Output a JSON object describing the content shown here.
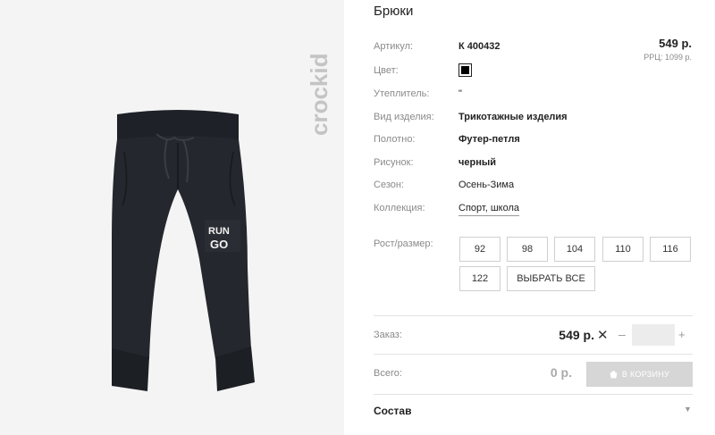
{
  "product": {
    "title": "Брюки",
    "brand": "crockid",
    "price": "549 р.",
    "rrp": "РРЦ: 1099 р.",
    "print_text": "RUN GO"
  },
  "attributes": [
    {
      "label": "Артикул:",
      "value": "К 400432"
    },
    {
      "label": "Цвет:",
      "value": ""
    },
    {
      "label": "Утеплитель:",
      "value": "\""
    },
    {
      "label": "Вид изделия:",
      "value": "Трикотажные изделия"
    },
    {
      "label": "Полотно:",
      "value": "Футер-петля"
    },
    {
      "label": "Рисунок:",
      "value": "черный"
    },
    {
      "label": "Сезон:",
      "value": "Осень-Зима"
    },
    {
      "label": "Коллекция:",
      "value": "Спорт, школа"
    }
  ],
  "sizes": {
    "label": "Рост/размер:",
    "options": [
      "92",
      "98",
      "104",
      "110",
      "116",
      "122"
    ],
    "select_all": "ВЫБРАТЬ ВСЕ"
  },
  "order": {
    "label": "Заказ:",
    "price": "549 р.",
    "times": "✕",
    "minus": "–",
    "plus": "+",
    "qty_value": ""
  },
  "total": {
    "label": "Всего:",
    "sum": "0 р.",
    "cart_button": "В КОРЗИНУ"
  },
  "composition": {
    "label": "Состав",
    "caret": "▼"
  },
  "colors": {
    "swatch": "#000000",
    "cart_button_bg": "#d6d6d6",
    "image_bg": "#f4f4f4"
  }
}
